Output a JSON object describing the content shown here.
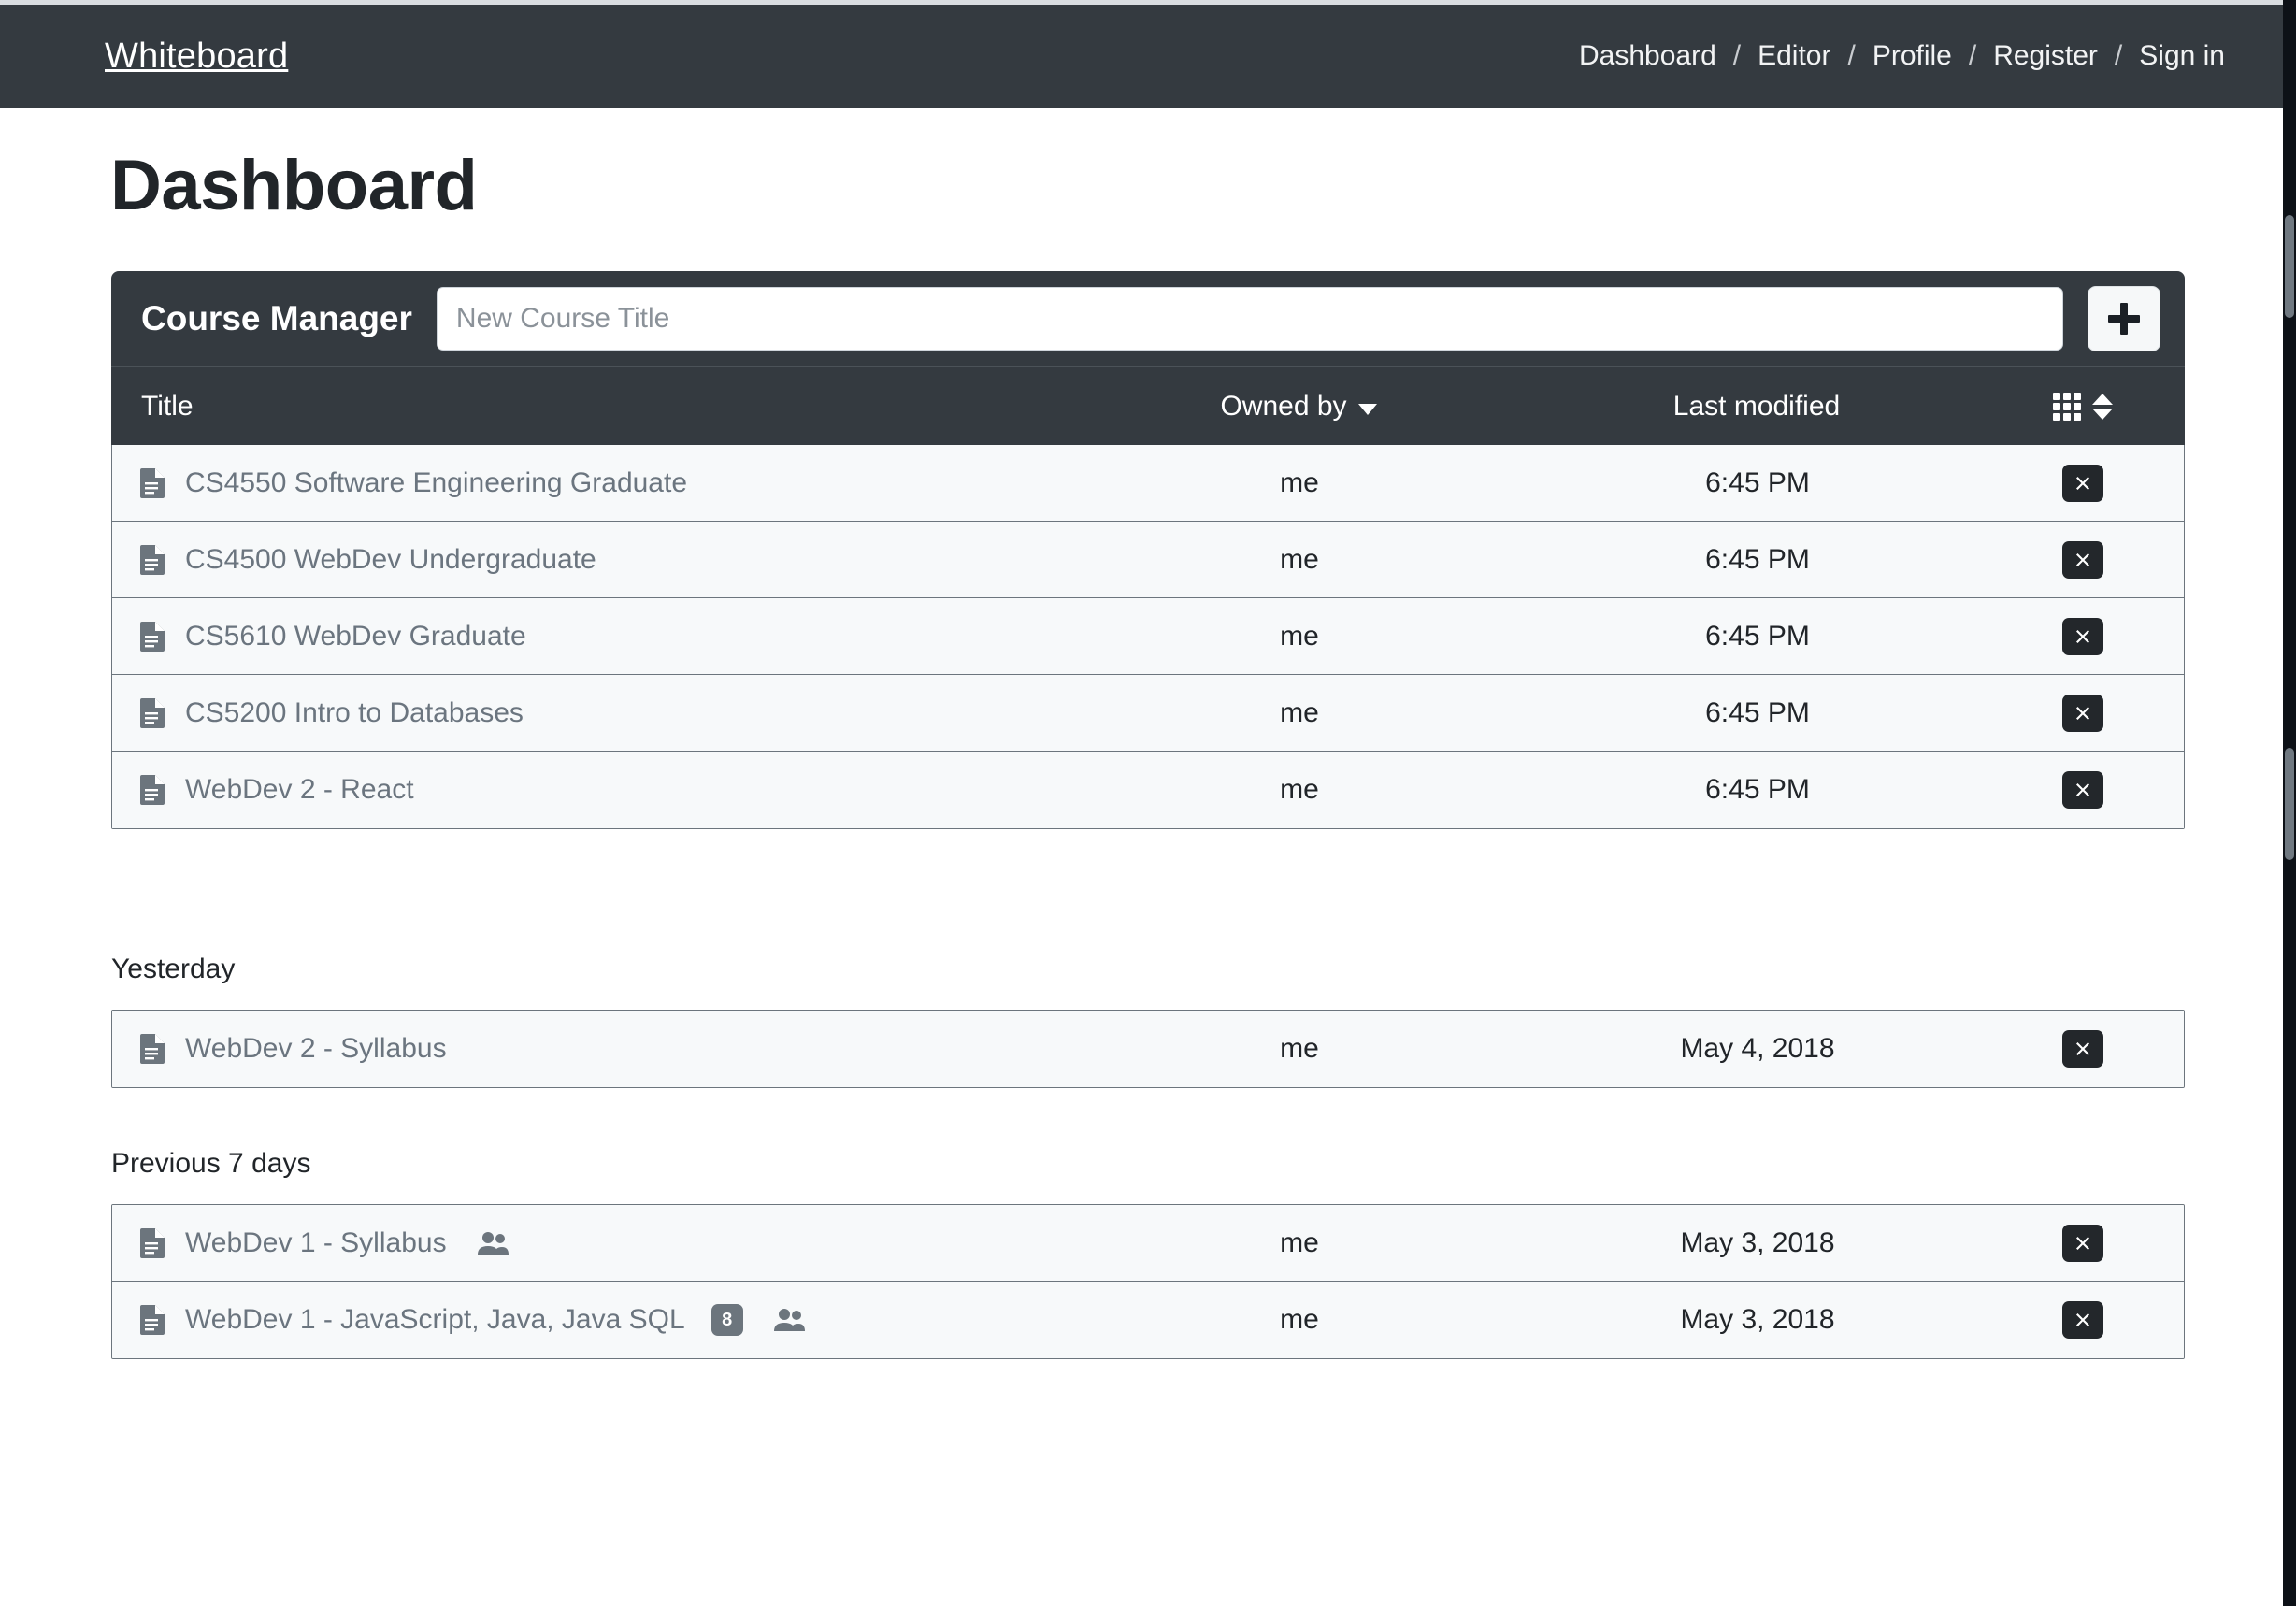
{
  "navbar": {
    "brand": "Whiteboard",
    "separator": "/",
    "links": [
      {
        "label": "Dashboard"
      },
      {
        "label": "Editor"
      },
      {
        "label": "Profile"
      },
      {
        "label": "Register"
      },
      {
        "label": "Sign in"
      }
    ]
  },
  "page": {
    "title": "Dashboard"
  },
  "course_manager": {
    "title": "Course Manager",
    "new_course_value": "",
    "new_course_placeholder": "New Course Title",
    "add_button_label": "+"
  },
  "table": {
    "columns": {
      "title": "Title",
      "owner": "Owned by",
      "modified": "Last modified"
    },
    "rows": [
      {
        "title": "CS4550 Software Engineering Graduate",
        "owner": "me",
        "modified": "6:45 PM",
        "badge": null,
        "shared": false
      },
      {
        "title": "CS4500 WebDev Undergraduate",
        "owner": "me",
        "modified": "6:45 PM",
        "badge": null,
        "shared": false
      },
      {
        "title": "CS5610 WebDev Graduate",
        "owner": "me",
        "modified": "6:45 PM",
        "badge": null,
        "shared": false
      },
      {
        "title": "CS5200 Intro to Databases",
        "owner": "me",
        "modified": "6:45 PM",
        "badge": null,
        "shared": false
      },
      {
        "title": "WebDev 2 - React",
        "owner": "me",
        "modified": "6:45 PM",
        "badge": null,
        "shared": false
      }
    ]
  },
  "groups": [
    {
      "label": "Yesterday",
      "rows": [
        {
          "title": "WebDev 2 - Syllabus",
          "owner": "me",
          "modified": "May 4, 2018",
          "badge": null,
          "shared": false
        }
      ]
    },
    {
      "label": "Previous 7 days",
      "rows": [
        {
          "title": "WebDev 1 - Syllabus",
          "owner": "me",
          "modified": "May 3, 2018",
          "badge": null,
          "shared": true
        },
        {
          "title": "WebDev 1 - JavaScript, Java, Java SQL",
          "owner": "me",
          "modified": "May 3, 2018",
          "badge": "8",
          "shared": true
        }
      ]
    }
  ],
  "colors": {
    "navbar_bg": "#343a40",
    "row_bg": "#f7f9fa",
    "row_border": "#6c757d",
    "title_text": "#6b757f",
    "badge_bg": "#6c757d",
    "delete_bg": "#23272b"
  }
}
